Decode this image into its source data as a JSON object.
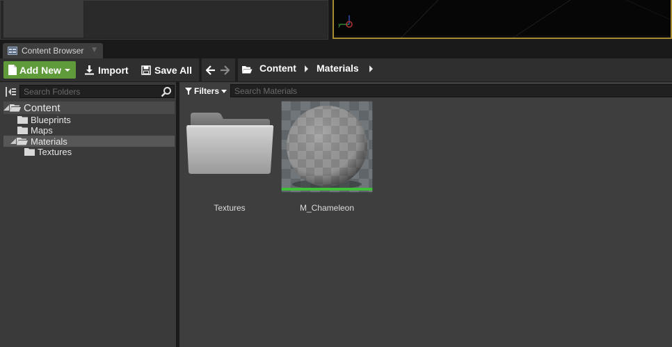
{
  "tab": {
    "label": "Content Browser"
  },
  "toolbar": {
    "add_new": "Add New",
    "import": "Import",
    "save_all": "Save All",
    "breadcrumbs": [
      "Content",
      "Materials"
    ]
  },
  "sources": {
    "search_placeholder": "Search Folders",
    "tree": [
      {
        "label": "Content"
      },
      {
        "label": "Blueprints"
      },
      {
        "label": "Maps"
      },
      {
        "label": "Materials"
      },
      {
        "label": "Textures"
      }
    ]
  },
  "assets": {
    "filters_label": "Filters",
    "search_placeholder": "Search Materials",
    "items": [
      {
        "name": "Textures"
      },
      {
        "name": "M_Chameleon"
      }
    ]
  },
  "colors": {
    "add_new_green": "#5f9a3b",
    "viewport_border": "#a98b34",
    "material_underline": "#3fbf3a"
  }
}
